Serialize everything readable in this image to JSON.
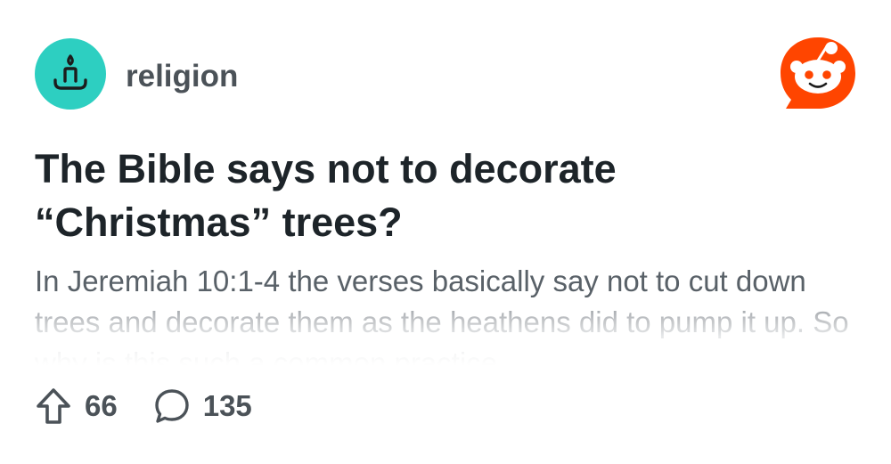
{
  "subreddit": {
    "name": "religion",
    "icon": "candle-icon",
    "icon_color": "#2dcfc1"
  },
  "brand": {
    "logo": "reddit-logo",
    "color": "#ff4500"
  },
  "post": {
    "title_lines": [
      "The Bible says not to decorate",
      "“Christmas” trees?"
    ],
    "body": "In Jeremiah 10:1-4 the verses basically say not to cut down trees and decorate them as the heathens did to pump it up. So why is this such a common practice"
  },
  "actions": {
    "upvote_icon": "upvote-arrow-icon",
    "upvotes": "66",
    "comment_icon": "comment-bubble-icon",
    "comments": "135"
  }
}
